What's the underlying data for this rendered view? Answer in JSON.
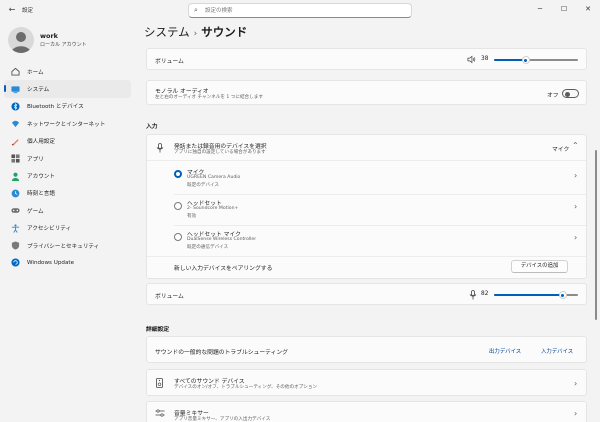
{
  "window": {
    "title": "設定",
    "minimize": "─",
    "maximize": "☐",
    "close": "✕",
    "back": "←"
  },
  "search": {
    "placeholder": "設定の検索"
  },
  "user": {
    "name": "work",
    "account": "ローカル アカウント"
  },
  "nav": [
    {
      "label": "ホーム",
      "icon": "home-icon"
    },
    {
      "label": "システム",
      "icon": "system-icon",
      "active": true
    },
    {
      "label": "Bluetooth とデバイス",
      "icon": "bluetooth-icon"
    },
    {
      "label": "ネットワークとインターネット",
      "icon": "network-icon"
    },
    {
      "label": "個人用設定",
      "icon": "personalization-icon"
    },
    {
      "label": "アプリ",
      "icon": "apps-icon"
    },
    {
      "label": "アカウント",
      "icon": "accounts-icon"
    },
    {
      "label": "時刻と言語",
      "icon": "time-language-icon"
    },
    {
      "label": "ゲーム",
      "icon": "gaming-icon"
    },
    {
      "label": "アクセシビリティ",
      "icon": "accessibility-icon"
    },
    {
      "label": "プライバシーとセキュリティ",
      "icon": "privacy-icon"
    },
    {
      "label": "Windows Update",
      "icon": "windows-update-icon"
    }
  ],
  "breadcrumb": {
    "parent": "システム",
    "separator": "›",
    "current": "サウンド"
  },
  "output": {
    "volume_label": "ボリューム",
    "volume_value": "38",
    "volume_level": 38,
    "mono_label": "モノラル オーディオ",
    "mono_sub": "左と右のオーディオ チャンネルを 1 つに結合します",
    "mono_state": "オフ"
  },
  "input": {
    "section_title": "入力",
    "select_label": "発話または録音用のデバイスを選択",
    "select_sub": "アプリに独自の設定している場合があります",
    "selected_device": "マイク",
    "devices": [
      {
        "name": "マイク",
        "model": "UGREEN Camera Audio",
        "note": "既定のデバイス",
        "selected": true
      },
      {
        "name": "ヘッドセット",
        "model": "2- Soundcore Motion+",
        "note": "有効",
        "selected": false
      },
      {
        "name": "ヘッドセット マイク",
        "model": "DualSense Wireless Controller",
        "note": "既定の通信デバイス",
        "selected": false
      }
    ],
    "pair_label": "新しい入力デバイスをペアリングする",
    "add_device_button": "デバイスの追加",
    "volume_label": "ボリューム",
    "volume_value": "82",
    "volume_level": 82
  },
  "advanced": {
    "section_title": "詳細設定",
    "troubleshoot_label": "サウンドの一般的な問題のトラブルシューティング",
    "output_devices_link": "出力デバイス",
    "input_devices_link": "入力デバイス",
    "all_devices_label": "すべてのサウンド デバイス",
    "all_devices_sub": "デバイスのオン/オフ、トラブルシューティング、その他のオプション",
    "mixer_label": "音量ミキサー",
    "mixer_sub": "アプリ音量ミキサー、アプリの入出力デバイス"
  },
  "colors": {
    "accent": "#005fb8",
    "background": "#f3f3f3",
    "card": "#fbfbfb"
  }
}
